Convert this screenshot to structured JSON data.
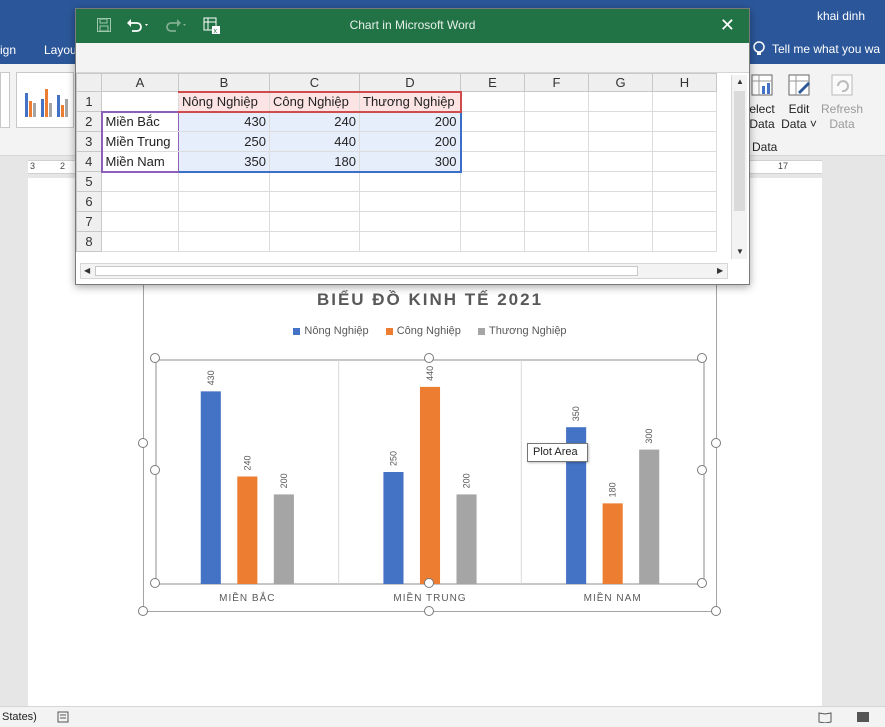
{
  "word": {
    "user_name": "khai dinh",
    "ribbon_tabs": [
      "ign",
      "Layou"
    ],
    "tell_me": "Tell me what you wa",
    "ribbon": {
      "select_data": [
        "elect",
        "Data"
      ],
      "edit_data": [
        "Edit",
        "Data ˅"
      ],
      "refresh_data": [
        "Refresh",
        "Data"
      ],
      "data_group_label": "Data"
    },
    "ruler_numbers": [
      "3",
      "2",
      "17"
    ],
    "status_left": "States)"
  },
  "excel": {
    "title": "Chart in Microsoft Word",
    "close_glyph": "✕",
    "columns": [
      "A",
      "B",
      "C",
      "D",
      "E",
      "F",
      "G",
      "H"
    ],
    "rows": [
      {
        "num": "1",
        "cells": [
          "",
          "Nông Nghiệp",
          "Công Nghiệp",
          "Thương Nghiệp",
          "",
          "",
          "",
          ""
        ]
      },
      {
        "num": "2",
        "cells": [
          "Miền Bắc",
          "430",
          "240",
          "200",
          "",
          "",
          "",
          ""
        ]
      },
      {
        "num": "3",
        "cells": [
          "Miền Trung",
          "250",
          "440",
          "200",
          "",
          "",
          "",
          ""
        ]
      },
      {
        "num": "4",
        "cells": [
          "Miền Nam",
          "350",
          "180",
          "300",
          "",
          "",
          "",
          ""
        ]
      },
      {
        "num": "5",
        "cells": [
          "",
          "",
          "",
          "",
          "",
          "",
          "",
          ""
        ]
      },
      {
        "num": "6",
        "cells": [
          "",
          "",
          "",
          "",
          "",
          "",
          "",
          ""
        ]
      },
      {
        "num": "7",
        "cells": [
          "",
          "",
          "",
          "",
          "",
          "",
          "",
          ""
        ]
      },
      {
        "num": "8",
        "cells": [
          "",
          "",
          "",
          "",
          "",
          "",
          "",
          ""
        ]
      }
    ]
  },
  "tooltip": "Plot Area",
  "colors": {
    "blue": "#4472c4",
    "orange": "#ed7d31",
    "gray": "#a5a5a5",
    "excel_green": "#217346",
    "word_blue": "#2b579a"
  },
  "chart_data": {
    "type": "bar",
    "title": "BIỂU ĐỒ KINH TẾ 2021",
    "categories": [
      "MIỀN BẮC",
      "MIỀN TRUNG",
      "MIỀN NAM"
    ],
    "series": [
      {
        "name": "Nông Nghiệp",
        "color": "#4472c4",
        "values": [
          430,
          250,
          350
        ]
      },
      {
        "name": "Công Nghiệp",
        "color": "#ed7d31",
        "values": [
          240,
          440,
          180
        ]
      },
      {
        "name": "Thương Nghiệp",
        "color": "#a5a5a5",
        "values": [
          200,
          200,
          300
        ]
      }
    ],
    "ylim": [
      0,
      500
    ],
    "grid": false,
    "legend": "top",
    "data_labels": "vertical"
  }
}
